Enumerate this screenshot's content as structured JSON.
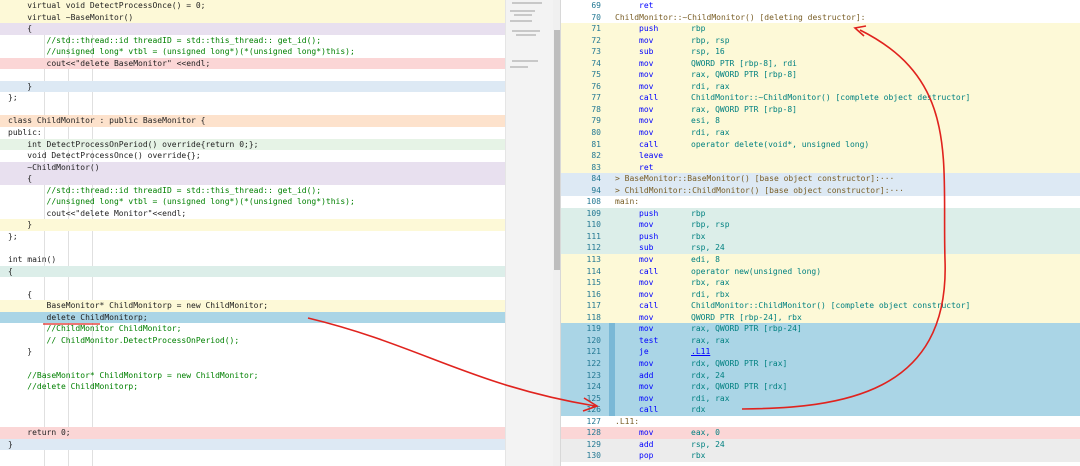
{
  "left_code": [
    {
      "code": "    virtual void DetectProcessOnce() = 0;",
      "bg": "bg-yellow"
    },
    {
      "code": "    virtual ~BaseMonitor()",
      "bg": "bg-yellow"
    },
    {
      "code": "    {",
      "bg": "bg-purple"
    },
    {
      "code": "        //std::thread::id threadID = std::this_thread:: get_id();",
      "bg": ""
    },
    {
      "code": "        //unsigned long* vtbl = (unsigned long*)(*(unsigned long*)this);",
      "bg": ""
    },
    {
      "code": "        cout<<\"delete BaseMonitor\" <<endl;",
      "bg": "bg-pink"
    },
    {
      "code": "",
      "bg": ""
    },
    {
      "code": "    }",
      "bg": "bg-blue"
    },
    {
      "code": "};",
      "bg": ""
    },
    {
      "code": "",
      "bg": ""
    },
    {
      "code": "class ChildMonitor : public BaseMonitor {",
      "bg": "bg-orange"
    },
    {
      "code": "public:",
      "bg": ""
    },
    {
      "code": "    int DetectProcessOnPeriod() override{return 0;};",
      "bg": "bg-green"
    },
    {
      "code": "    void DetectProcessOnce() override{};",
      "bg": ""
    },
    {
      "code": "    ~ChildMonitor()",
      "bg": "bg-purple"
    },
    {
      "code": "    {",
      "bg": "bg-purple"
    },
    {
      "code": "        //std::thread::id threadID = std::this_thread:: get_id();",
      "bg": ""
    },
    {
      "code": "        //unsigned long* vtbl = (unsigned long*)(*(unsigned long*)this);",
      "bg": ""
    },
    {
      "code": "        cout<<\"delete Monitor\"<<endl;",
      "bg": ""
    },
    {
      "code": "    }",
      "bg": "bg-yellow"
    },
    {
      "code": "};",
      "bg": ""
    },
    {
      "code": "",
      "bg": ""
    },
    {
      "code": "int main()",
      "bg": ""
    },
    {
      "code": "{",
      "bg": "bg-teal"
    },
    {
      "code": "",
      "bg": ""
    },
    {
      "code": "    {",
      "bg": ""
    },
    {
      "code": "        BaseMonitor* ChildMonitorp = new ChildMonitor;",
      "bg": "bg-yellow"
    },
    {
      "code": "        delete ChildMonitorp;",
      "bg": "bg-sel"
    },
    {
      "code": "        //ChildMonitor ChildMonitor;",
      "bg": ""
    },
    {
      "code": "        // ChildMonitor.DetectProcessOnPeriod();",
      "bg": ""
    },
    {
      "code": "    }",
      "bg": ""
    },
    {
      "code": "",
      "bg": ""
    },
    {
      "code": "    //BaseMonitor* ChildMonitorp = new ChildMonitor;",
      "bg": ""
    },
    {
      "code": "    //delete ChildMonitorp;",
      "bg": ""
    },
    {
      "code": "",
      "bg": ""
    },
    {
      "code": "",
      "bg": ""
    },
    {
      "code": "",
      "bg": ""
    },
    {
      "code": "    return 0;",
      "bg": "bg-pink"
    },
    {
      "code": "}",
      "bg": "bg-blue"
    }
  ],
  "asm": [
    {
      "n": "69",
      "label": "",
      "op": "ret",
      "args": "",
      "bg": ""
    },
    {
      "n": "70",
      "label": "ChildMonitor::~ChildMonitor() [deleting destructor]:",
      "op": "",
      "args": "",
      "bg": ""
    },
    {
      "n": "71",
      "label": "",
      "op": "push",
      "args": "rbp",
      "bg": "bg-yellow"
    },
    {
      "n": "72",
      "label": "",
      "op": "mov",
      "args": "rbp, rsp",
      "bg": "bg-yellow"
    },
    {
      "n": "73",
      "label": "",
      "op": "sub",
      "args": "rsp, 16",
      "bg": "bg-yellow"
    },
    {
      "n": "74",
      "label": "",
      "op": "mov",
      "args": "QWORD PTR [rbp-8], rdi",
      "bg": "bg-yellow"
    },
    {
      "n": "75",
      "label": "",
      "op": "mov",
      "args": "rax, QWORD PTR [rbp-8]",
      "bg": "bg-yellow"
    },
    {
      "n": "76",
      "label": "",
      "op": "mov",
      "args": "rdi, rax",
      "bg": "bg-yellow"
    },
    {
      "n": "77",
      "label": "",
      "op": "call",
      "args": "ChildMonitor::~ChildMonitor() [complete object destructor]",
      "bg": "bg-yellow"
    },
    {
      "n": "78",
      "label": "",
      "op": "mov",
      "args": "rax, QWORD PTR [rbp-8]",
      "bg": "bg-yellow"
    },
    {
      "n": "79",
      "label": "",
      "op": "mov",
      "args": "esi, 8",
      "bg": "bg-yellow"
    },
    {
      "n": "80",
      "label": "",
      "op": "mov",
      "args": "rdi, rax",
      "bg": "bg-yellow"
    },
    {
      "n": "81",
      "label": "",
      "op": "call",
      "args": "operator delete(void*, unsigned long)",
      "bg": "bg-yellow"
    },
    {
      "n": "82",
      "label": "",
      "op": "leave",
      "args": "",
      "bg": "bg-yellow"
    },
    {
      "n": "83",
      "label": "",
      "op": "ret",
      "args": "",
      "bg": "bg-yellow"
    },
    {
      "n": "84",
      "label": "> BaseMonitor::BaseMonitor() [base object constructor]:···",
      "op": "",
      "args": "",
      "bg": "bg-blue"
    },
    {
      "n": "94",
      "label": "> ChildMonitor::ChildMonitor() [base object constructor]:···",
      "op": "",
      "args": "",
      "bg": "bg-blue"
    },
    {
      "n": "108",
      "label": "main:",
      "op": "",
      "args": "",
      "bg": ""
    },
    {
      "n": "109",
      "label": "",
      "op": "push",
      "args": "rbp",
      "bg": "bg-teal"
    },
    {
      "n": "110",
      "label": "",
      "op": "mov",
      "args": "rbp, rsp",
      "bg": "bg-teal"
    },
    {
      "n": "111",
      "label": "",
      "op": "push",
      "args": "rbx",
      "bg": "bg-teal"
    },
    {
      "n": "112",
      "label": "",
      "op": "sub",
      "args": "rsp, 24",
      "bg": "bg-teal"
    },
    {
      "n": "113",
      "label": "",
      "op": "mov",
      "args": "edi, 8",
      "bg": "bg-yellow"
    },
    {
      "n": "114",
      "label": "",
      "op": "call",
      "args": "operator new(unsigned long)",
      "bg": "bg-yellow"
    },
    {
      "n": "115",
      "label": "",
      "op": "mov",
      "args": "rbx, rax",
      "bg": "bg-yellow"
    },
    {
      "n": "116",
      "label": "",
      "op": "mov",
      "args": "rdi, rbx",
      "bg": "bg-yellow"
    },
    {
      "n": "117",
      "label": "",
      "op": "call",
      "args": "ChildMonitor::ChildMonitor() [complete object constructor]",
      "bg": "bg-yellow"
    },
    {
      "n": "118",
      "label": "",
      "op": "mov",
      "args": "QWORD PTR [rbp-24], rbx",
      "bg": "bg-yellow"
    },
    {
      "n": "119",
      "label": "",
      "op": "mov",
      "args": "rax, QWORD PTR [rbp-24]",
      "bg": "bg-sel"
    },
    {
      "n": "120",
      "label": "",
      "op": "test",
      "args": "rax, rax",
      "bg": "bg-sel"
    },
    {
      "n": "121",
      "label": "",
      "op": "je",
      "args": ".L11",
      "bg": "bg-sel",
      "link": true
    },
    {
      "n": "122",
      "label": "",
      "op": "mov",
      "args": "rdx, QWORD PTR [rax]",
      "bg": "bg-sel"
    },
    {
      "n": "123",
      "label": "",
      "op": "add",
      "args": "rdx, 24",
      "bg": "bg-sel"
    },
    {
      "n": "124",
      "label": "",
      "op": "mov",
      "args": "rdx, QWORD PTR [rdx]",
      "bg": "bg-sel"
    },
    {
      "n": "125",
      "label": "",
      "op": "mov",
      "args": "rdi, rax",
      "bg": "bg-sel"
    },
    {
      "n": "126",
      "label": "",
      "op": "call",
      "args": "rdx",
      "bg": "bg-sel"
    },
    {
      "n": "127",
      "label": ".L11:",
      "op": "",
      "args": "",
      "bg": ""
    },
    {
      "n": "128",
      "label": "",
      "op": "mov",
      "args": "eax, 0",
      "bg": "bg-pink"
    },
    {
      "n": "129",
      "label": "",
      "op": "add",
      "args": "rsp, 24",
      "bg": "bg-grey"
    },
    {
      "n": "130",
      "label": "",
      "op": "pop",
      "args": "rbx",
      "bg": "bg-grey"
    }
  ],
  "colors": {
    "arrow": "#e0231e",
    "link": "#0000ff",
    "line_number": "#237893"
  }
}
